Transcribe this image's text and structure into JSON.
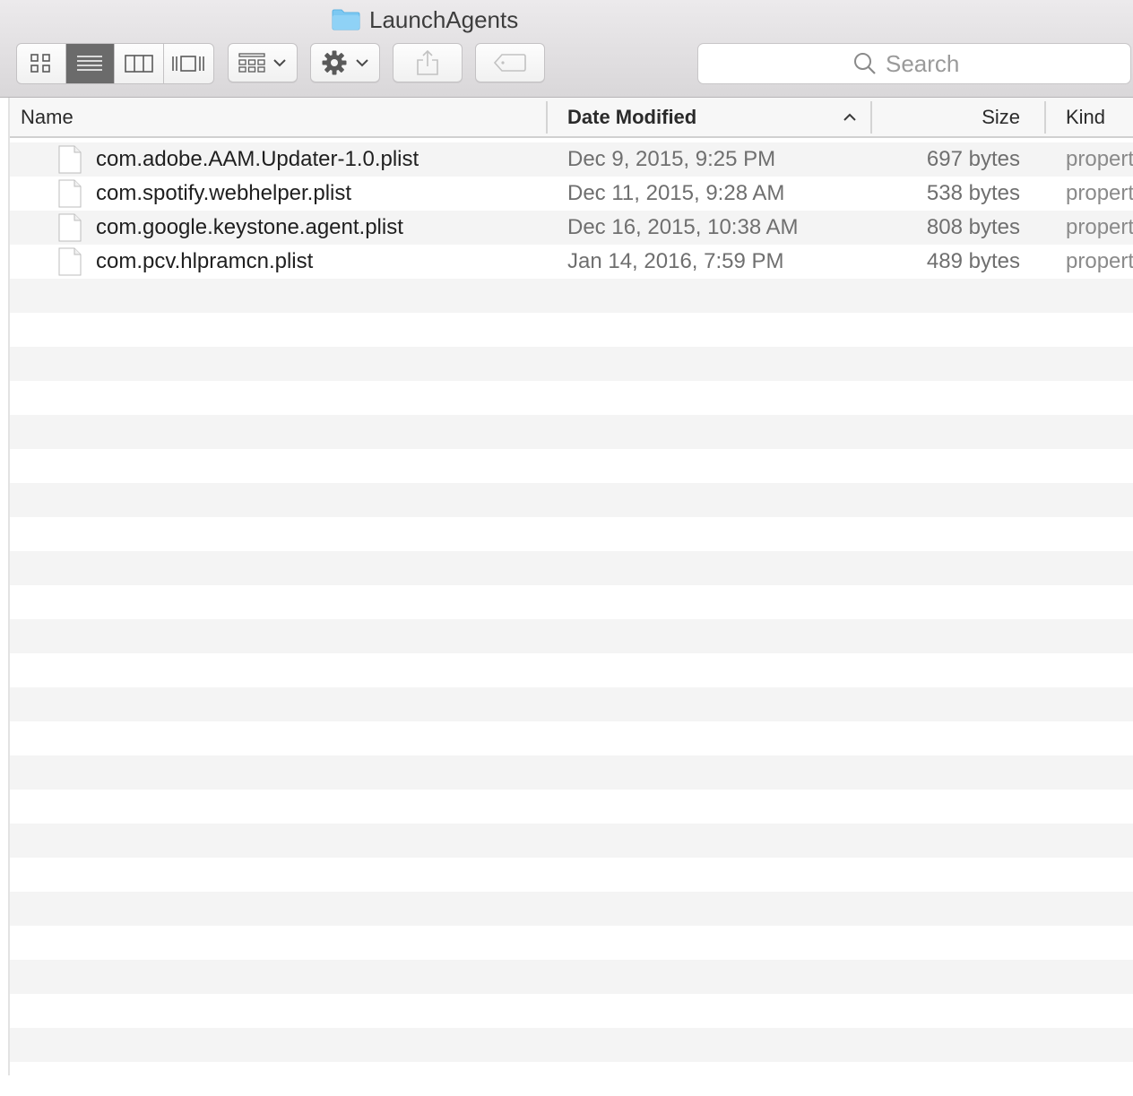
{
  "window": {
    "title": "LaunchAgents",
    "folder_icon": "folder-icon"
  },
  "toolbar": {
    "view_modes": [
      {
        "name": "icon-view",
        "icon": "grid-icon"
      },
      {
        "name": "list-view",
        "icon": "list-icon",
        "active": true
      },
      {
        "name": "column-view",
        "icon": "columns-icon"
      },
      {
        "name": "cover-flow-view",
        "icon": "cover-flow-icon"
      }
    ],
    "arrange_icon": "arrange-icon",
    "action_icon": "gear-icon",
    "share_icon": "share-icon",
    "tags_icon": "tag-icon",
    "search": {
      "placeholder": "Search",
      "value": ""
    }
  },
  "columns": {
    "name": "Name",
    "date_modified": "Date Modified",
    "size": "Size",
    "kind": "Kind",
    "sort_column": "Date Modified",
    "sort_direction": "ascending"
  },
  "files": [
    {
      "name": "com.adobe.AAM.Updater-1.0.plist",
      "date": "Dec 9, 2015, 9:25 PM",
      "size": "697 bytes",
      "kind": "propert"
    },
    {
      "name": "com.spotify.webhelper.plist",
      "date": "Dec 11, 2015, 9:28 AM",
      "size": "538 bytes",
      "kind": "propert"
    },
    {
      "name": "com.google.keystone.agent.plist",
      "date": "Dec 16, 2015, 10:38 AM",
      "size": "808 bytes",
      "kind": "propert"
    },
    {
      "name": "com.pcv.hlpramcn.plist",
      "date": "Jan 14, 2016, 7:59 PM",
      "size": "489 bytes",
      "kind": "propert"
    }
  ],
  "colors": {
    "row_alt": "#f4f4f4",
    "active_segment": "#6b6b6b",
    "folder": "#6fc3f0"
  }
}
